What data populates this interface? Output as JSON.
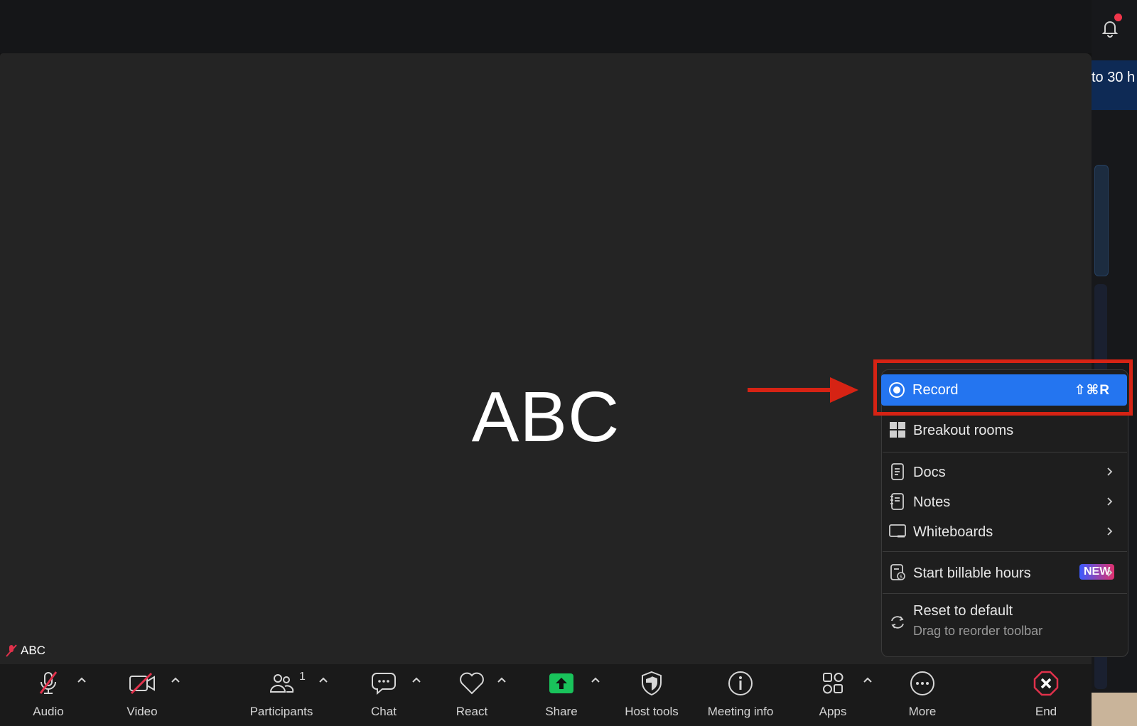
{
  "window": {
    "banner_text": "to 30 h",
    "participant_name": "ABC",
    "tile_label": "ABC"
  },
  "toolbar": {
    "audio": "Audio",
    "video": "Video",
    "participants": "Participants",
    "participants_count": "1",
    "chat": "Chat",
    "react": "React",
    "share": "Share",
    "host_tools": "Host tools",
    "meeting_info": "Meeting info",
    "apps": "Apps",
    "more": "More",
    "end": "End"
  },
  "more_menu": {
    "record": {
      "label": "Record",
      "shortcut": "⇧⌘R"
    },
    "breakout_rooms": "Breakout rooms",
    "docs": "Docs",
    "notes": "Notes",
    "whiteboards": "Whiteboards",
    "billable": {
      "label": "Start billable hours",
      "badge": "NEW"
    },
    "reset": {
      "label": "Reset to default",
      "sublabel": "Drag to reorder toolbar"
    }
  },
  "colors": {
    "accent": "#2475f0",
    "annotation_red": "#d62314",
    "share_green": "#19c35b",
    "end_red": "#e0314b"
  }
}
